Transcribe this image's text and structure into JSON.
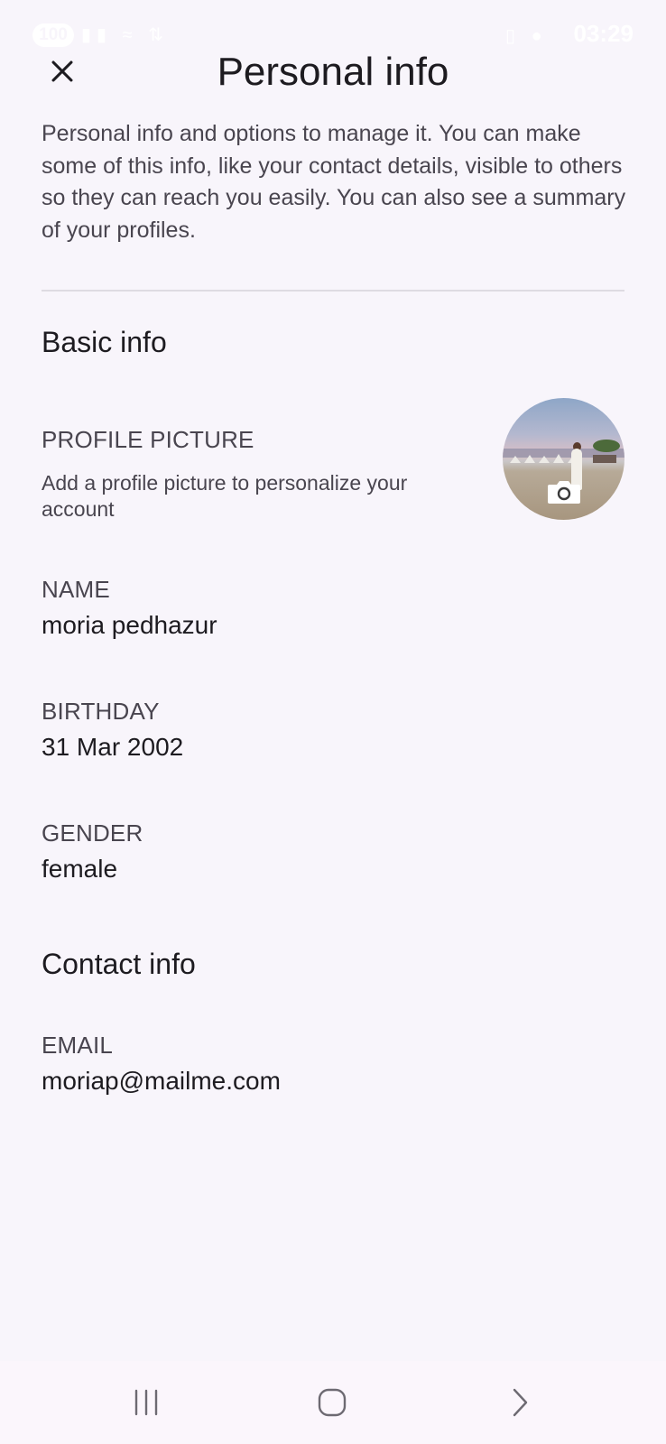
{
  "status_bar": {
    "battery": "100",
    "time": "03:29"
  },
  "header": {
    "title": "Personal info",
    "close_icon": "close-icon"
  },
  "intro": "Personal info and options to manage it. You can make some of this info, like your contact details, visible to others so they can reach you easily. You can also see a summary of your profiles.",
  "basic_info": {
    "title": "Basic info",
    "profile_picture": {
      "label": "PROFILE PICTURE",
      "description": "Add a profile picture to personalize your account",
      "camera_icon": "camera-icon"
    },
    "name": {
      "label": "NAME",
      "value": "moria pedhazur"
    },
    "birthday": {
      "label": "BIRTHDAY",
      "value": "31 Mar 2002"
    },
    "gender": {
      "label": "GENDER",
      "value": "female"
    }
  },
  "contact_info": {
    "title": "Contact info",
    "email": {
      "label": "EMAIL",
      "value": "moriap@mailme.com"
    }
  },
  "nav_bar": {
    "recents_icon": "recents-icon",
    "home_icon": "home-icon",
    "back_icon": "back-icon"
  }
}
